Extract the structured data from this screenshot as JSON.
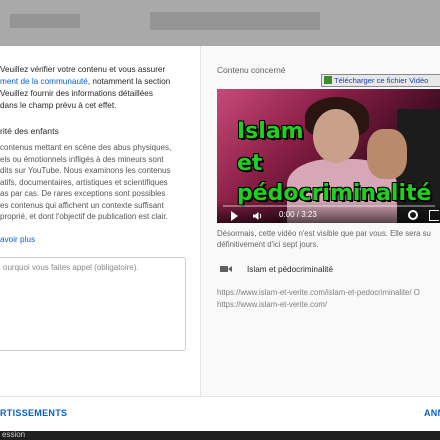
{
  "report_dialog": {
    "left": {
      "intro_before": "Veuillez vérifier votre contenu et vous assurer",
      "intro_link": "ment de la communauté",
      "intro_after_link": ", notamment la section",
      "intro_line3": "Veuillez fournir des informations détaillées",
      "intro_line4": "dans le champ prévu à cet effet.",
      "section_title": "rité des enfants",
      "section_lines": [
        "contenus mettant en scène des abus physiques,",
        "els ou émotionnels infligés à des mineurs sont",
        "dits sur YouTube. Nous examinons les contenus",
        "atifs, documentaires, artistiques et scientifiques",
        "as par cas. De rares exceptions sont possibles",
        "es contenus qui affichent un contexte suffisant",
        "proprié, et dont l'objectif de publication est clair."
      ],
      "learn_more": "avoir plus",
      "textarea_placeholder": "ourquoi vous faites appel (obligatoire)."
    },
    "right": {
      "section_label": "Contenu concerné",
      "download_button": "Télécharger ce fichier Vidéo",
      "video_overlay": [
        "Islam",
        "et",
        "pédocriminalité"
      ],
      "video_time": "0:00 / 3:23",
      "notice_line1": "Désormais, cette vidéo n'est visible que par vous. Elle sera su",
      "notice_line2": "définitivement d'ici sept jours.",
      "video_title": "Islam et pédocriminalité",
      "description_lines": [
        "https://www.islam-et-verite.com/islam-et-pedocriminalite/ O",
        "https://www.islam-et-verite.com/"
      ]
    },
    "footer": {
      "left_button": "RTISSEMENTS",
      "right_button": "ANN"
    }
  },
  "background": {
    "bottom_strip_text": "ession"
  }
}
